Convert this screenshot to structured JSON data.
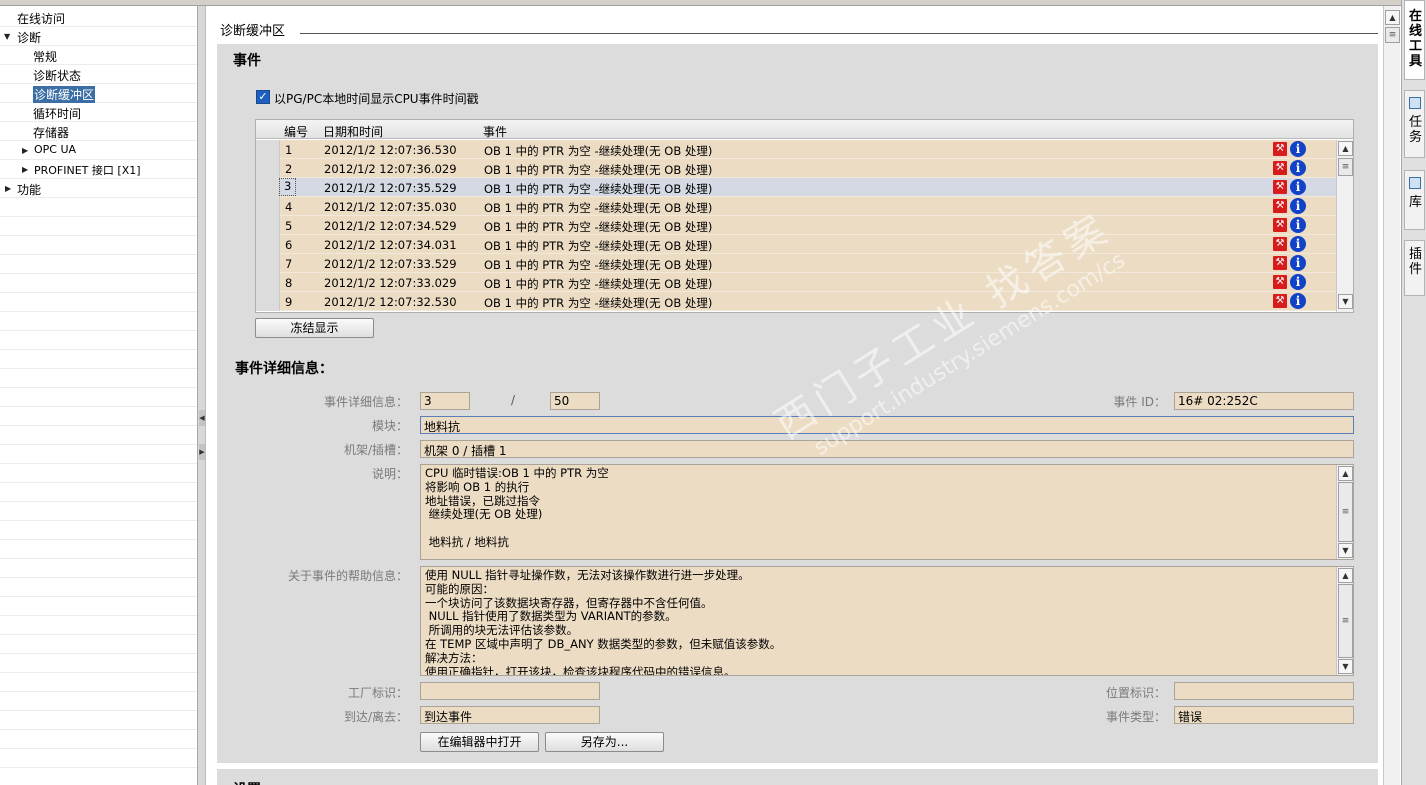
{
  "nav": {
    "items": [
      {
        "label": "在线访问",
        "level": 0,
        "expander": "none",
        "selected": false
      },
      {
        "label": "诊断",
        "level": 0,
        "expander": "expanded",
        "selected": false
      },
      {
        "label": "常规",
        "level": 2,
        "expander": "none",
        "selected": false
      },
      {
        "label": "诊断状态",
        "level": 2,
        "expander": "none",
        "selected": false
      },
      {
        "label": "诊断缓冲区",
        "level": 2,
        "expander": "none",
        "selected": true
      },
      {
        "label": "循环时间",
        "level": 2,
        "expander": "none",
        "selected": false
      },
      {
        "label": "存储器",
        "level": 2,
        "expander": "none",
        "selected": false
      },
      {
        "label": "OPC UA",
        "level": 1,
        "expander": "collapsed",
        "selected": false
      },
      {
        "label": "PROFINET 接口 [X1]",
        "level": 1,
        "expander": "collapsed",
        "selected": false
      },
      {
        "label": "功能",
        "level": 0,
        "expander": "collapsed",
        "selected": false
      }
    ]
  },
  "section": {
    "title": "诊断缓冲区"
  },
  "events": {
    "heading": "事件",
    "show_local_time": {
      "label": "以PG/PC本地时间显示CPU事件时间戳",
      "checked": true
    },
    "columns": {
      "num": "编号",
      "datetime": "日期和时间",
      "event": "事件"
    },
    "rows": [
      {
        "num": "1",
        "datetime": "2012/1/2 12:07:36.530",
        "event": "OB 1 中的 PTR 为空 -继续处理(无 OB 处理)",
        "selected": false
      },
      {
        "num": "2",
        "datetime": "2012/1/2 12:07:36.029",
        "event": "OB 1 中的 PTR 为空 -继续处理(无 OB 处理)",
        "selected": false
      },
      {
        "num": "3",
        "datetime": "2012/1/2 12:07:35.529",
        "event": "OB 1 中的 PTR 为空 -继续处理(无 OB 处理)",
        "selected": true
      },
      {
        "num": "4",
        "datetime": "2012/1/2 12:07:35.030",
        "event": "OB 1 中的 PTR 为空 -继续处理(无 OB 处理)",
        "selected": false
      },
      {
        "num": "5",
        "datetime": "2012/1/2 12:07:34.529",
        "event": "OB 1 中的 PTR 为空 -继续处理(无 OB 处理)",
        "selected": false
      },
      {
        "num": "6",
        "datetime": "2012/1/2 12:07:34.031",
        "event": "OB 1 中的 PTR 为空 -继续处理(无 OB 处理)",
        "selected": false
      },
      {
        "num": "7",
        "datetime": "2012/1/2 12:07:33.529",
        "event": "OB 1 中的 PTR 为空 -继续处理(无 OB 处理)",
        "selected": false
      },
      {
        "num": "8",
        "datetime": "2012/1/2 12:07:33.029",
        "event": "OB 1 中的 PTR 为空 -继续处理(无 OB 处理)",
        "selected": false
      },
      {
        "num": "9",
        "datetime": "2012/1/2 12:07:32.530",
        "event": "OB 1 中的 PTR 为空 -继续处理(无 OB 处理)",
        "selected": false
      }
    ],
    "freeze_button": "冻结显示"
  },
  "details": {
    "heading": "事件详细信息：",
    "detail_label": "事件详细信息：",
    "detail_current": "3",
    "detail_separator": "/",
    "detail_total": "50",
    "event_id_label": "事件 ID：",
    "event_id": "16# 02:252C",
    "module_label": "模块：",
    "module": "地料抗",
    "rack_label": "机架/插槽：",
    "rack": "机架 0 / 插槽 1",
    "desc_label": "说明：",
    "description": "CPU 临时错误:OB 1 中的 PTR 为空\n将影响 OB 1 的执行\n地址错误，已跳过指令\n 继续处理(无 OB 处理)\n\n 地料抗 / 地料抗",
    "help_label": "关于事件的帮助信息：",
    "help": "使用 NULL 指针寻址操作数，无法对该操作数进行进一步处理。\n可能的原因：\n一个块访问了该数据块寄存器，但寄存器中不含任何值。\n NULL 指针使用了数据类型为 VARIANT的参数。\n 所调用的块无法评估该参数。\n在 TEMP 区域中声明了 DB_ANY 数据类型的参数，但未赋值该参数。\n解决方法：\n使用正确指针，打开该块，检查该块程序代码中的错误信息。",
    "plant_label": "工厂标识：",
    "plant": "",
    "location_label": "位置标识：",
    "location": "",
    "incoming_label": "到达/离去：",
    "incoming": "到达事件",
    "type_label": "事件类型：",
    "type": "错误",
    "open_editor_button": "在编辑器中打开",
    "save_as_button": "另存为..."
  },
  "settings": {
    "heading": "设置"
  },
  "dock": {
    "tabs": [
      "在线工具",
      "任务",
      "库",
      "插件"
    ]
  },
  "watermark": {
    "line1": "西门子工业 找答案",
    "line2": "support.industry.siemens.com/cs"
  },
  "colors": {
    "row_bg": "#ecdcc4",
    "selected_row_bg": "#d4d9e3",
    "nav_selected": "#3a6ea5",
    "error_icon": "#d81c1c",
    "info_icon": "#1142c8"
  }
}
